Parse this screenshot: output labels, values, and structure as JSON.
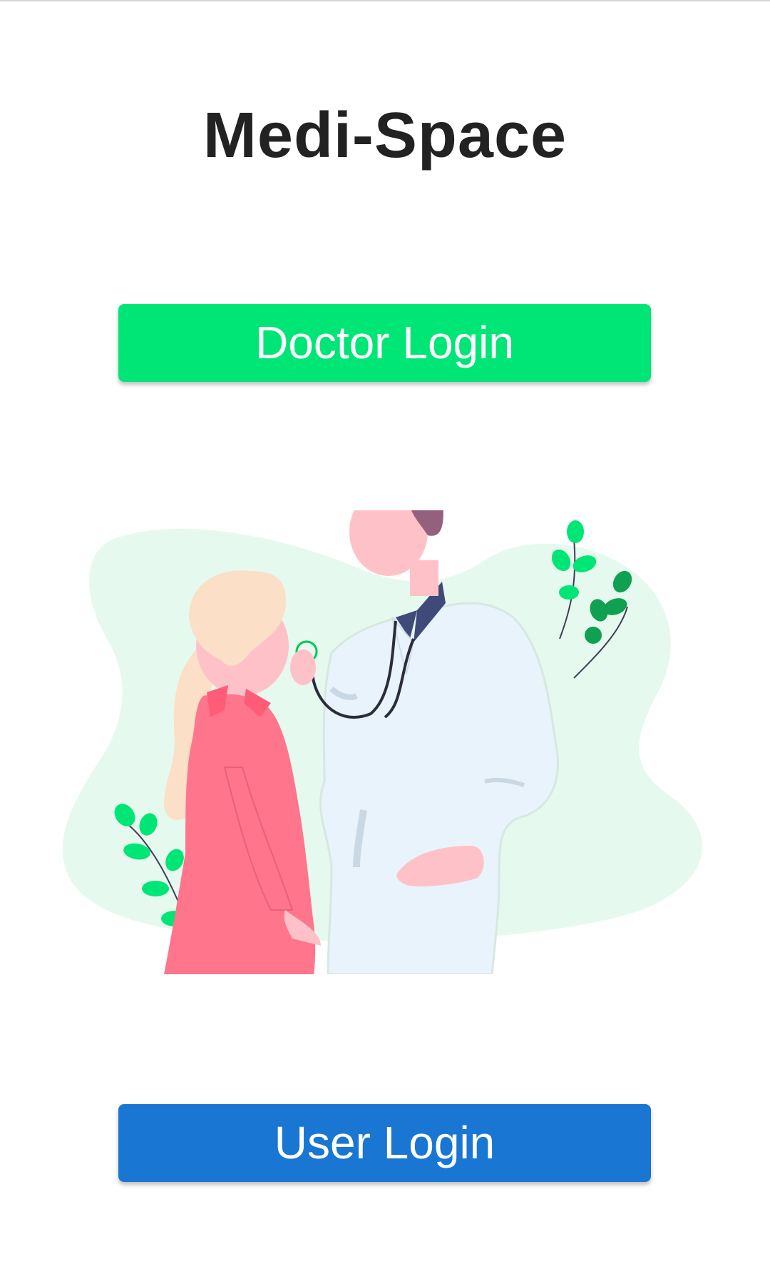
{
  "app": {
    "title": "Medi-Space"
  },
  "buttons": {
    "doctor_login": "Doctor Login",
    "user_login": "User Login"
  },
  "colors": {
    "doctor_button": "#00e676",
    "user_button": "#1976d2",
    "title_text": "#222222",
    "background_blob": "#e6f9ee"
  },
  "illustration": {
    "icon": "doctor-patient-illustration"
  }
}
